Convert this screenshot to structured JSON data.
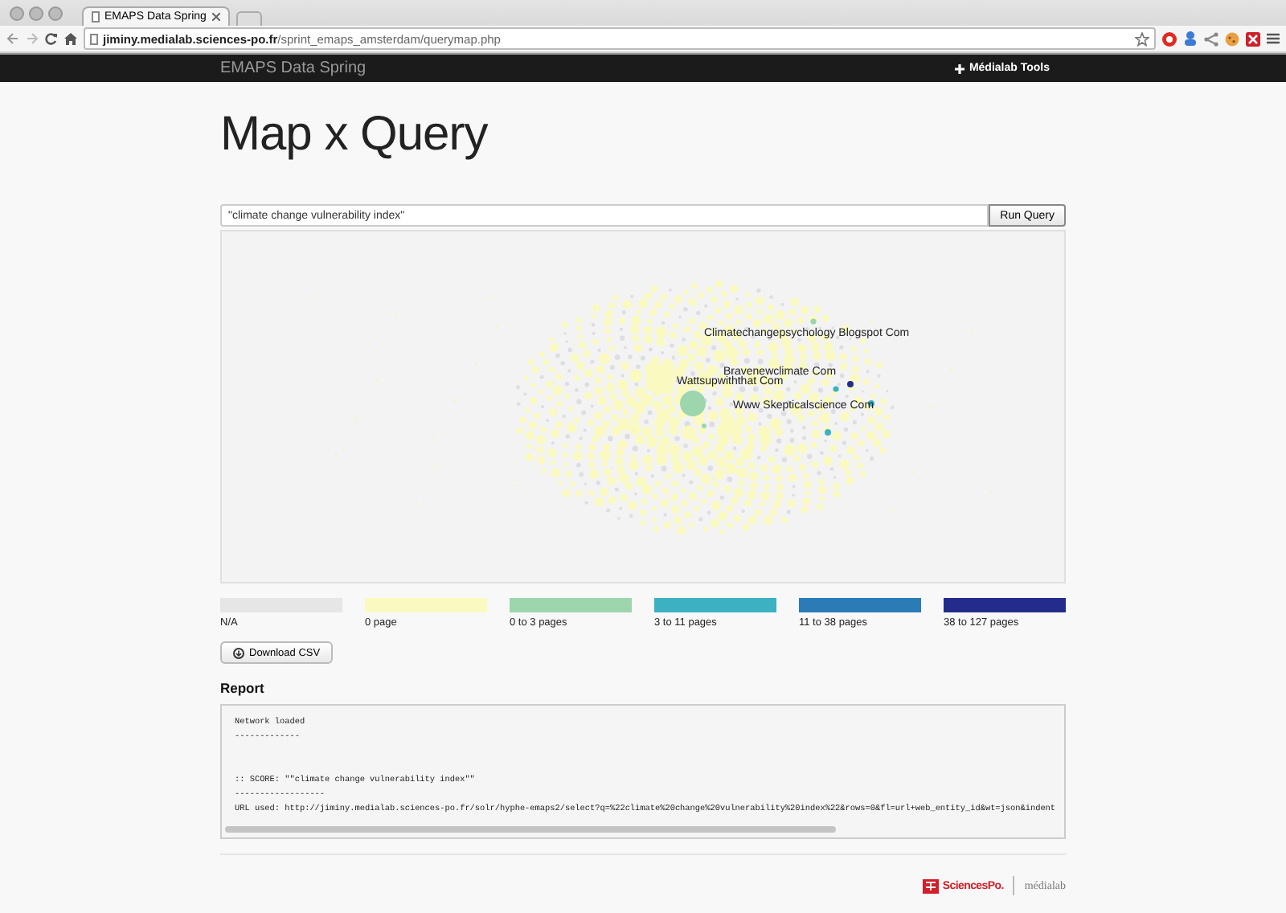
{
  "browser": {
    "tab_title": "EMAPS Data Spring",
    "url_host": "jiminy.medialab.sciences-po.fr",
    "url_path": "/sprint_emaps_amsterdam/querymap.php"
  },
  "navbar": {
    "brand": "EMAPS Data Spring",
    "menu": "Médialab Tools"
  },
  "title": "Map x Query",
  "search": {
    "value": "\"climate change vulnerability index\"",
    "button": "Run Query"
  },
  "graph": {
    "nodes": [
      {
        "label": "Climatechangepsychology Blogspot Com",
        "color": "#9dd5ac"
      },
      {
        "label": "Bravenewclimate Com",
        "color": "#3bb1c2"
      },
      {
        "label": "Wattsupwiththat Com",
        "color": "#fafac0"
      },
      {
        "label": "Www Skepticalscience Com",
        "color": "#9dd5ac"
      }
    ]
  },
  "legend": [
    {
      "label": "N/A",
      "color": "#e6e6e6"
    },
    {
      "label": "0 page",
      "color": "#fafac0"
    },
    {
      "label": "0 to 3 pages",
      "color": "#9dd5ac"
    },
    {
      "label": "3 to 11 pages",
      "color": "#3bb1c2"
    },
    {
      "label": "11 to 38 pages",
      "color": "#2b7bb7"
    },
    {
      "label": "38 to 127 pages",
      "color": "#232c8a"
    }
  ],
  "download_button": "Download CSV",
  "report": {
    "heading": "Report",
    "sections": [
      {
        "lines": [
          "Network loaded",
          "-------------"
        ]
      },
      {
        "lines": [
          ":: SCORE: \"\"climate change vulnerability index\"\"",
          "------------------",
          "URL used: http://jiminy.medialab.sciences-po.fr/solr/hyphe-emaps2/select?q=%22climate%20change%20vulnerability%20index%22&rows=0&fl=url+web_entity_id&wt=json&indent"
        ]
      }
    ]
  },
  "footer": {
    "logo": "SciencesPo.",
    "lab": "médialab"
  }
}
